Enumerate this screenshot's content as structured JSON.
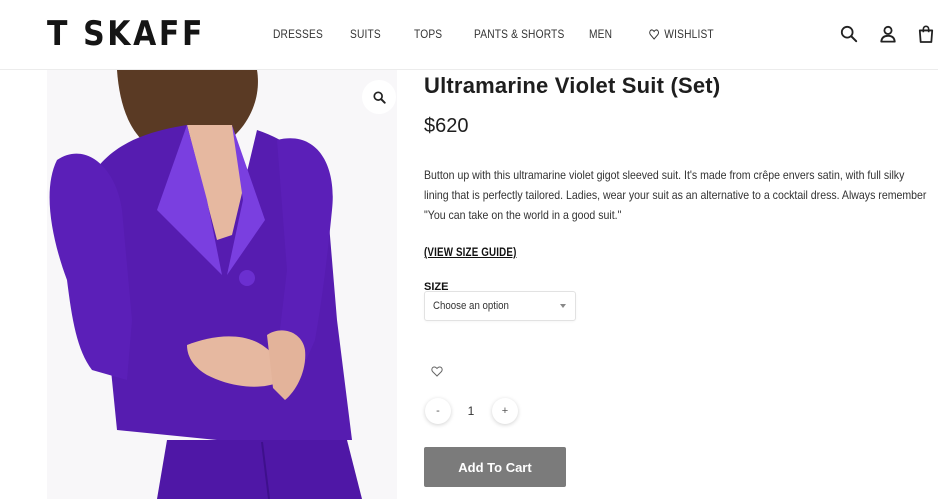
{
  "header": {
    "logo": "T SKAFF",
    "nav": [
      {
        "label": "DRESSES"
      },
      {
        "label": "SUITS"
      },
      {
        "label": "TOPS"
      },
      {
        "label": "PANTS & SHORTS"
      },
      {
        "label": "MEN"
      },
      {
        "label": "WISHLIST",
        "icon": "heart-icon"
      }
    ],
    "icons": [
      "search-icon",
      "user-icon",
      "bag-icon"
    ]
  },
  "product": {
    "title": "Ultramarine Violet Suit (Set)",
    "price": "$620",
    "description": "Button up with this ultramarine violet gigot sleeved suit. It's made from crêpe envers satin, with full silky lining that is perfectly tailored. Ladies, wear your suit as an alternative to a cocktail dress. Always remember \"You can take on the world in a good suit.\"",
    "size_guide": "(VIEW SIZE GUIDE)",
    "size_label": "SIZE",
    "size_select_value": "Choose an option",
    "quantity": "1",
    "qty_minus": "-",
    "qty_plus": "+",
    "add_to_cart": "Add To Cart",
    "suit_color": "#5a1fb8",
    "image_icon": "zoom-icon"
  }
}
